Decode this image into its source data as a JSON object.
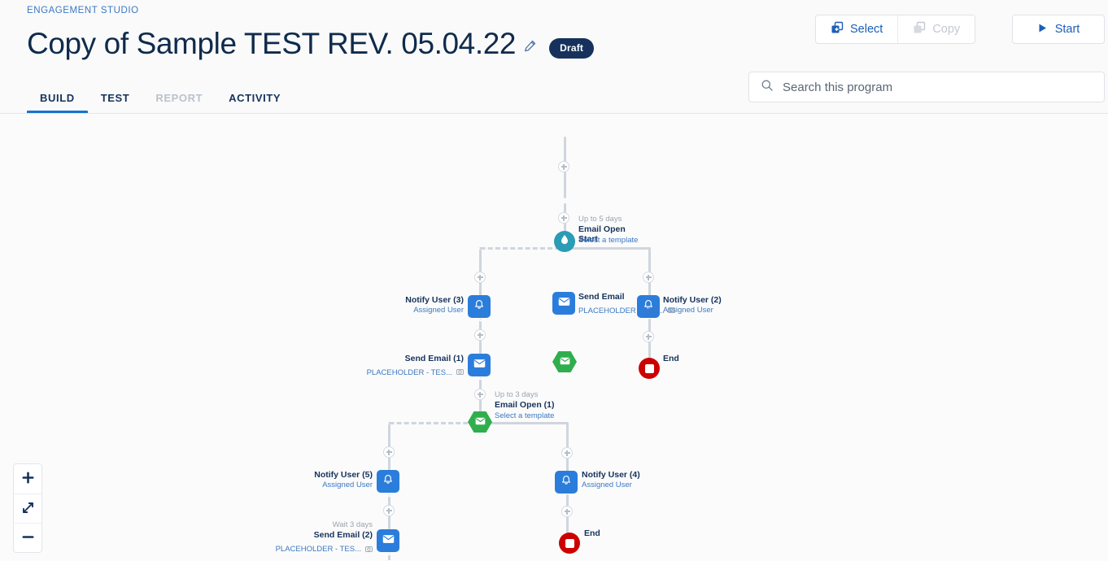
{
  "header": {
    "eyebrow": "ENGAGEMENT STUDIO",
    "title": "Copy of Sample TEST REV. 05.04.22",
    "edit_icon": "pencil-icon",
    "status_badge": "Draft",
    "tabs": [
      {
        "label": "BUILD",
        "state": "active"
      },
      {
        "label": "TEST",
        "state": "normal"
      },
      {
        "label": "REPORT",
        "state": "disabled"
      },
      {
        "label": "ACTIVITY",
        "state": "normal"
      }
    ],
    "buttons": {
      "select": {
        "label": "Select",
        "icon": "select-copy-plus-icon",
        "state": "enabled"
      },
      "copy": {
        "label": "Copy",
        "icon": "copy-icon",
        "state": "disabled"
      },
      "start": {
        "label": "Start",
        "icon": "play-icon",
        "state": "enabled"
      }
    },
    "search": {
      "placeholder": "Search this program",
      "value": "",
      "icon": "search-icon"
    }
  },
  "colors": {
    "accent_blue": "#1b5eb8",
    "tab_underline": "#1773cf",
    "node_blue": "#2b7ddb",
    "node_green": "#2fae4d",
    "node_teal": "#2a9cb5",
    "node_red": "#cc0000",
    "badge_navy": "#16325c",
    "line_grey": "#cfd6dd",
    "canvas_bg": "#fbfbfb"
  },
  "zoom_controls": {
    "zoom_in": "+",
    "fit": "fit-to-screen",
    "zoom_out": "−"
  },
  "flow": {
    "nodes": [
      {
        "id": "start",
        "type": "start",
        "icon": "water-drop-icon",
        "title": "Start",
        "pre": "",
        "sub": "",
        "sub_icon": "",
        "side": "right"
      },
      {
        "id": "email0",
        "type": "email",
        "icon": "envelope-icon",
        "title": "Send Email",
        "pre": "",
        "sub": "PLACEHOLDER - TES...",
        "sub_icon": "image-icon",
        "side": "right"
      },
      {
        "id": "open0",
        "type": "rule",
        "icon": "envelope-icon",
        "title": "Email Open",
        "pre": "Up to 5 days",
        "sub": "Select a template",
        "sub_icon": "",
        "side": "right"
      },
      {
        "id": "notify2",
        "type": "notify",
        "icon": "bell-icon",
        "title": "Notify User (2)",
        "pre": "",
        "sub": "Assigned User",
        "sub_icon": "",
        "side": "right"
      },
      {
        "id": "end0",
        "type": "end",
        "icon": "stop-icon",
        "title": "End",
        "pre": "",
        "sub": "",
        "sub_icon": "",
        "side": "right"
      },
      {
        "id": "notify3",
        "type": "notify",
        "icon": "bell-icon",
        "title": "Notify User (3)",
        "pre": "",
        "sub": "Assigned User",
        "sub_icon": "",
        "side": "left"
      },
      {
        "id": "email1",
        "type": "email",
        "icon": "envelope-icon",
        "title": "Send Email (1)",
        "pre": "",
        "sub": "PLACEHOLDER - TES...",
        "sub_icon": "image-icon",
        "side": "left"
      },
      {
        "id": "open1",
        "type": "rule",
        "icon": "envelope-icon",
        "title": "Email Open (1)",
        "pre": "Up to 3 days",
        "sub": "Select a template",
        "sub_icon": "",
        "side": "right"
      },
      {
        "id": "notify4",
        "type": "notify",
        "icon": "bell-icon",
        "title": "Notify User (4)",
        "pre": "",
        "sub": "Assigned User",
        "sub_icon": "",
        "side": "right"
      },
      {
        "id": "end1",
        "type": "end",
        "icon": "stop-icon",
        "title": "End",
        "pre": "",
        "sub": "",
        "sub_icon": "",
        "side": "right"
      },
      {
        "id": "notify5",
        "type": "notify",
        "icon": "bell-icon",
        "title": "Notify User (5)",
        "pre": "",
        "sub": "Assigned User",
        "sub_icon": "",
        "side": "left"
      },
      {
        "id": "email2",
        "type": "email",
        "icon": "envelope-icon",
        "title": "Send Email (2)",
        "pre": "Wait 3 days",
        "sub": "PLACEHOLDER - TES...",
        "sub_icon": "image-icon",
        "side": "left"
      }
    ]
  }
}
